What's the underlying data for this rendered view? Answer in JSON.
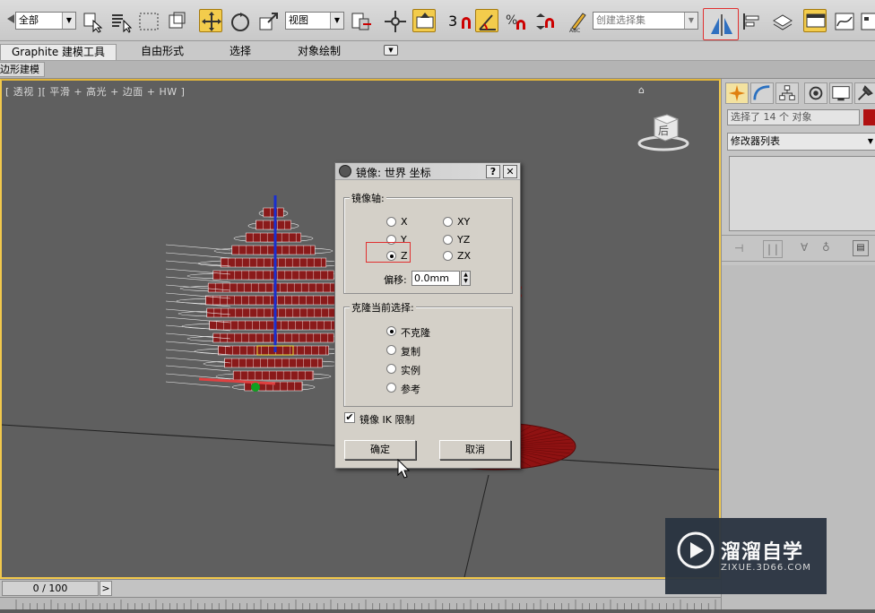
{
  "toolbar": {
    "selection_filter": "全部",
    "ref_coord": "视图",
    "named_selection_placeholder": "创建选择集",
    "snap_label": "3"
  },
  "ribbon": {
    "tabs": [
      "Graphite 建模工具",
      "自由形式",
      "选择",
      "对象绘制"
    ],
    "subtab": "边形建模"
  },
  "viewport": {
    "label": "[ 透视 ][ 平滑 + 高光 + 边面 + HW ]",
    "viewcube_face": "后"
  },
  "panel": {
    "selection_info": "选择了 14 个 对象",
    "modifier_list": "修改器列表",
    "accent_color": "#b01010"
  },
  "dialog": {
    "title": "镜像: 世界 坐标",
    "help": "?",
    "close": "✕",
    "mirror_axis": {
      "label": "镜像轴:",
      "options": [
        "X",
        "Y",
        "Z",
        "XY",
        "YZ",
        "ZX"
      ],
      "selected": "Z",
      "offset_label": "偏移:",
      "offset_value": "0.0mm"
    },
    "clone": {
      "label": "克隆当前选择:",
      "options": [
        "不克隆",
        "复制",
        "实例",
        "参考"
      ],
      "selected": "不克隆"
    },
    "mirror_ik": {
      "label": "镜像 IK 限制",
      "checked": true
    },
    "ok": "确定",
    "cancel": "取消"
  },
  "timeline": {
    "frame": "0 / 100",
    "next": ">"
  },
  "watermark": {
    "brand": "溜溜自学",
    "url": "ZIXUE.3D66.COM"
  }
}
